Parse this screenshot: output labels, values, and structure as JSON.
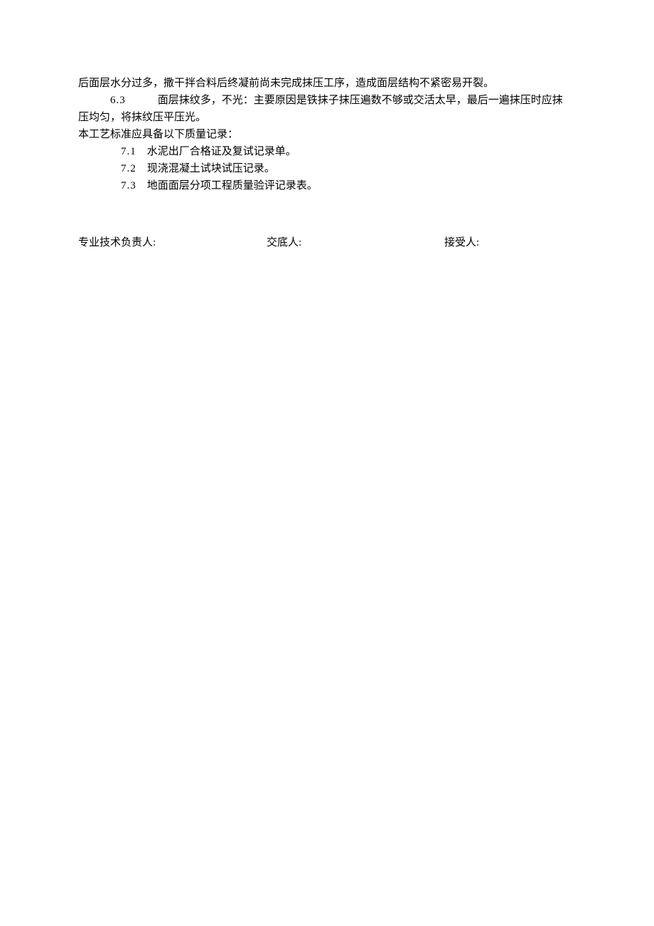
{
  "body": {
    "line1": "后面层水分过多，撒干拌合料后终凝前尚未完成抹压工序，造成面层结构不紧密易开裂。",
    "line2_num": "6.3",
    "line2_text": "　　　面层抹纹多，不光：主要原因是铁抹子抹压遍数不够或交活太早，最后一遍抹压时应抹",
    "line3": "压均匀，将抹纹压平压光。",
    "line4": "本工艺标准应具备以下质量记录：",
    "item71_num": "7.1",
    "item71_text": "　水泥出厂合格证及复试记录单。",
    "item72_num": "7.2",
    "item72_text": "　现浇混凝土试块试压记录。",
    "item73_num": "7.3",
    "item73_text": "　地面面层分项工程质量验评记录表。"
  },
  "signatures": {
    "tech_lead": "专业技术负责人:",
    "briefer": "交底人:",
    "receiver": "接受人:"
  }
}
